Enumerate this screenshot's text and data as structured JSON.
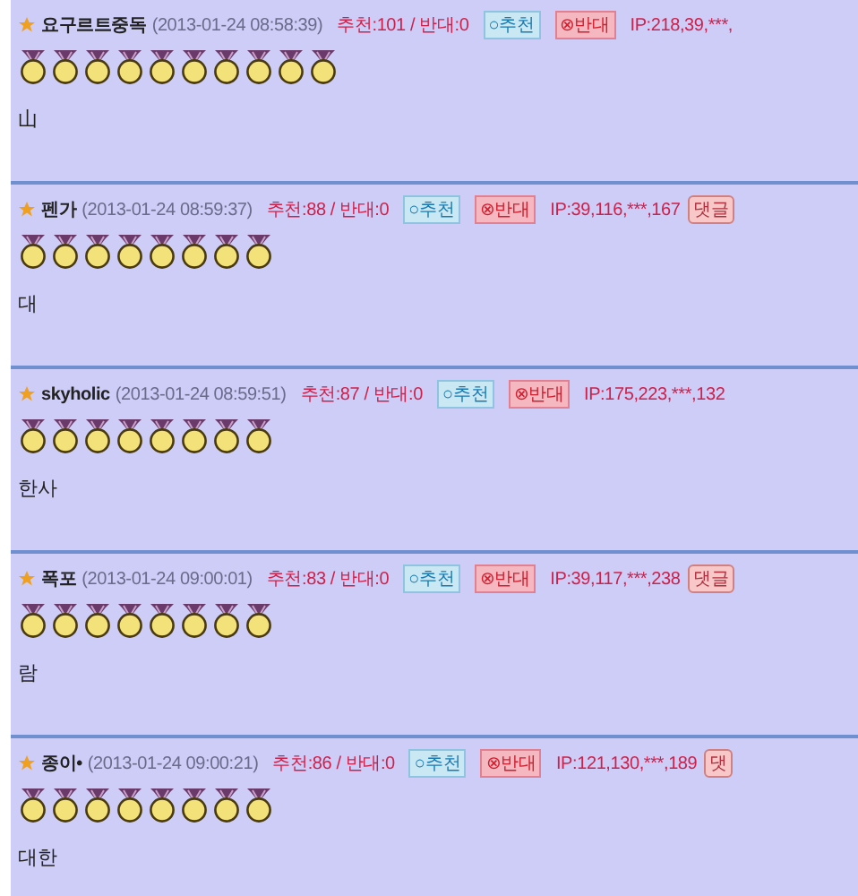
{
  "comments": [
    {
      "author": "요구르트중독",
      "time": "(2013-01-24 08:58:39)",
      "votes": "추천:101 / 반대:0",
      "up_button": "○추천",
      "down_button": "⊗반대",
      "ip": "IP:218,39,***,",
      "stars": 10,
      "body": "山"
    },
    {
      "author": "펜가",
      "time": "(2013-01-24 08:59:37)",
      "votes": "추천:88 / 반대:0",
      "up_button": "○추천",
      "down_button": "⊗반대",
      "ip": "IP:39,116,***,167",
      "reply_button": "댓글",
      "stars": 8,
      "body": "대"
    },
    {
      "author": "skyholic",
      "time": "(2013-01-24 08:59:51)",
      "votes": "추천:87 / 반대:0",
      "up_button": "○추천",
      "down_button": "⊗반대",
      "ip": "IP:175,223,***,132",
      "stars": 8,
      "body": "한사"
    },
    {
      "author": "폭포",
      "time": "(2013-01-24 09:00:01)",
      "votes": "추천:83 / 반대:0",
      "up_button": "○추천",
      "down_button": "⊗반대",
      "ip": "IP:39,117,***,238",
      "reply_button": "댓글",
      "stars": 8,
      "body": "람"
    },
    {
      "author": "종이•",
      "time": "(2013-01-24 09:00:21)",
      "votes": "추천:86 / 반대:0",
      "up_button": "○추천",
      "down_button": "⊗반대",
      "ip": "IP:121,130,***,189",
      "reply_button": "댓",
      "stars": 8,
      "body": "대한"
    }
  ]
}
